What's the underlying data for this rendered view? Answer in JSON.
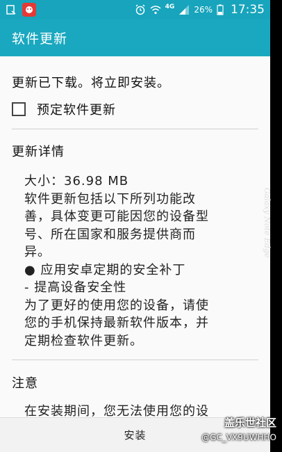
{
  "status_bar": {
    "network_label": "4G",
    "battery": "26%",
    "time": "17:35"
  },
  "action_bar": {
    "title": "软件更新"
  },
  "content": {
    "message": "更新已下载。将立即安装。",
    "checkbox_label": "预定软件更新",
    "details_title": "更新详情",
    "details_lines": [
      "大小：36.98 MB",
      "软件更新包括以下所列功能改",
      "善，具体变更可能因您的设备型",
      "号、所在国家和服务提供商而",
      "异。",
      "● 应用安卓定期的安全补丁",
      "- 提高设备安全性",
      "为了更好的使用您的设备，请使",
      "您的手机保持最新软件版本，并",
      "定期检查软件更新。"
    ],
    "notice_title": "注意",
    "notice_text": "在安装期间，您无法使用您的设"
  },
  "bottom_bar": {
    "install_label": "安装"
  },
  "edge": {
    "text": "Galaxy Note Edge"
  },
  "watermark": {
    "line1": "盖乐世社区",
    "line2": "@GC_VX9UWHHO"
  },
  "colors": {
    "accent": "#1aa8c0"
  }
}
